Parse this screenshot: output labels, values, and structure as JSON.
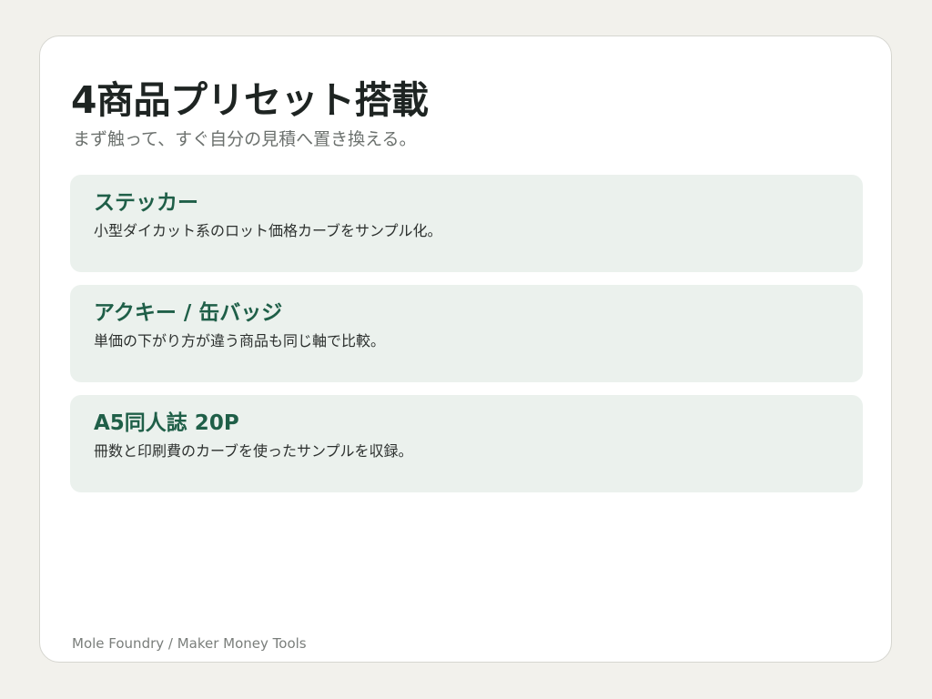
{
  "page": {
    "title": "4商品プリセット搭載",
    "subtitle": "まず触って、すぐ自分の見積へ置き換える。"
  },
  "presets": [
    {
      "name": "ステッカー",
      "description": "小型ダイカット系のロット価格カーブをサンプル化。"
    },
    {
      "name": "アクキー / 缶バッジ",
      "description": "単価の下がり方が違う商品も同じ軸で比較。"
    },
    {
      "name": "A5同人誌 20P",
      "description": "冊数と印刷費のカーブを使ったサンプルを収録。"
    }
  ],
  "footer": {
    "brand": "Mole Foundry / Maker Money Tools"
  },
  "colors": {
    "page_background": "#f2f1ec",
    "card_background": "#ffffff",
    "preset_background": "#ebf1ed",
    "accent": "#1f5f48"
  }
}
